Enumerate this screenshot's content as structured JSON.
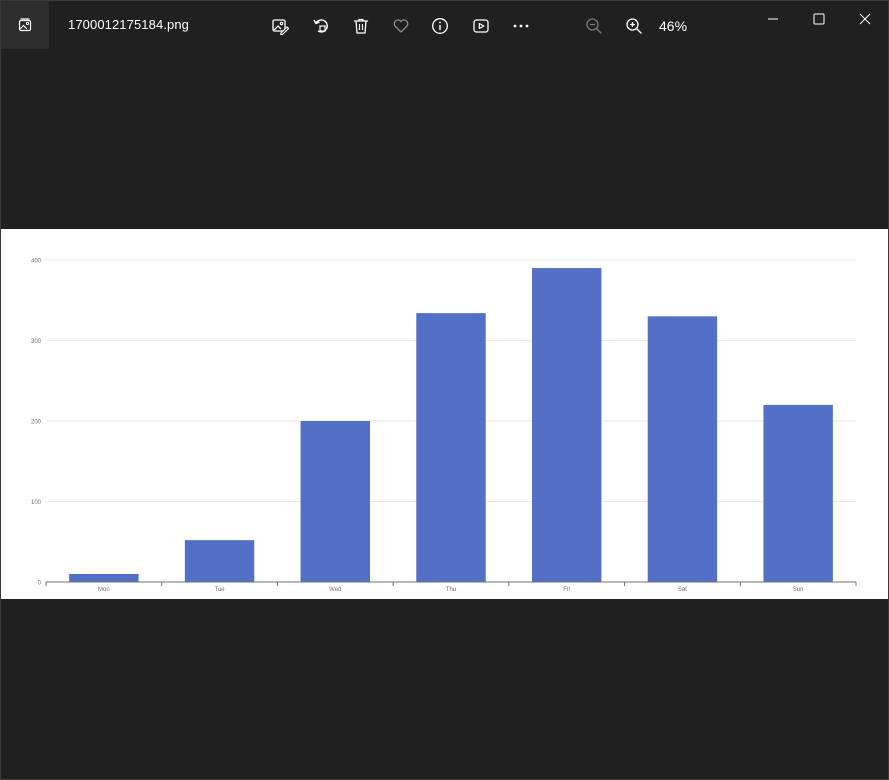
{
  "window": {
    "filename": "1700012175184.png",
    "zoom": "46%"
  },
  "toolbar": {
    "icons": [
      "gallery-icon",
      "edit-image-icon",
      "rotate-icon",
      "delete-icon",
      "favorite-icon",
      "info-icon",
      "slideshow-icon",
      "more-icon",
      "zoom-out-icon",
      "zoom-in-icon"
    ]
  },
  "window_controls": [
    "minimize-icon",
    "maximize-icon",
    "close-icon"
  ],
  "colors": {
    "background": "#202020",
    "bar": "#5470c6",
    "axis": "#6e7079",
    "grid": "#e8e8e8"
  },
  "chart_data": {
    "type": "bar",
    "categories": [
      "Mon",
      "Tue",
      "Wed",
      "Thu",
      "Fri",
      "Sat",
      "Sun"
    ],
    "values": [
      10,
      52,
      200,
      334,
      390,
      330,
      220
    ],
    "title": "",
    "xlabel": "",
    "ylabel": "",
    "ylim": [
      0,
      400
    ],
    "yticks": [
      0,
      100,
      200,
      300,
      400
    ],
    "grid": true
  }
}
